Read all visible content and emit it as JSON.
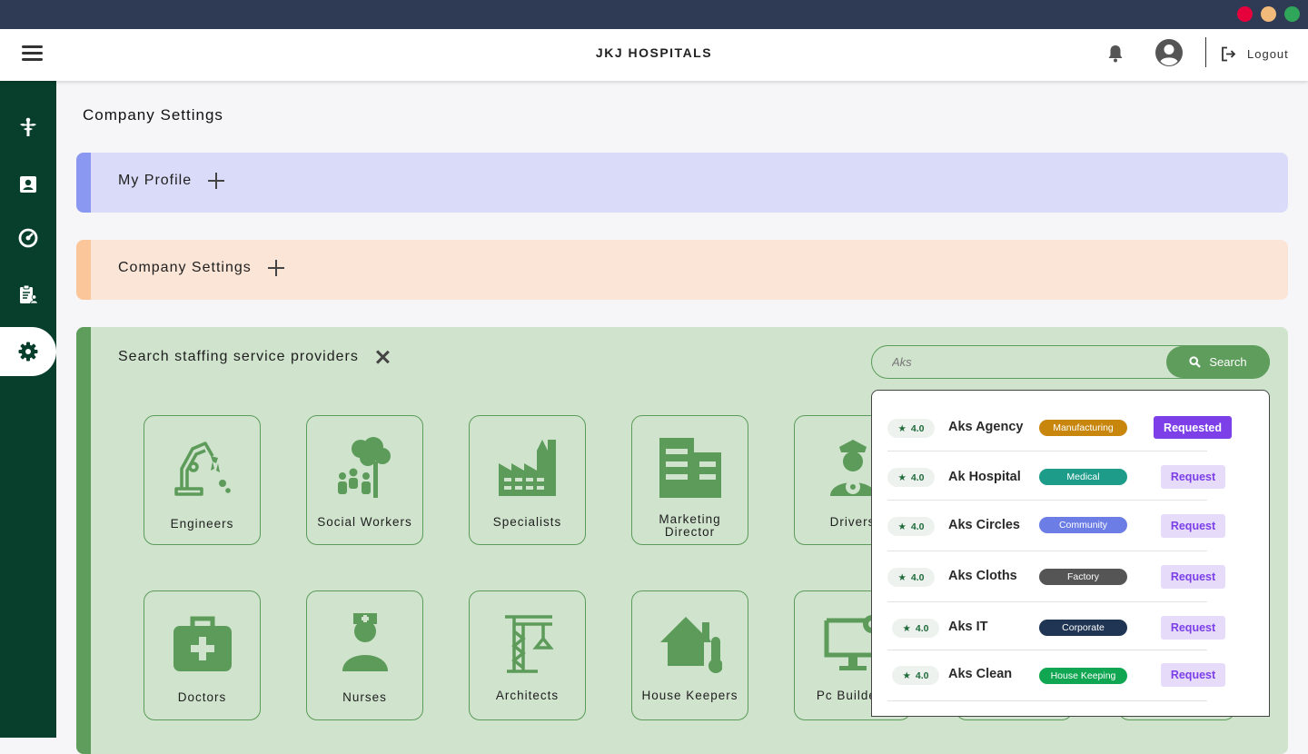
{
  "window": {
    "controls": [
      "close",
      "minimize",
      "maximize"
    ]
  },
  "header": {
    "brand": "JKJ HOSPITALS",
    "logout_label": "Logout"
  },
  "sidebar": {
    "items": [
      "hospital-icon",
      "profile-card-icon",
      "dashboard-gauge-icon",
      "clipboard-users-icon",
      "settings-icon"
    ],
    "active": "settings-icon"
  },
  "page": {
    "title": "Company Settings"
  },
  "panels": {
    "profile": {
      "title": "My Profile"
    },
    "company": {
      "title": "Company Settings"
    },
    "search": {
      "title": "Search staffing service providers"
    }
  },
  "search": {
    "value": "Aks",
    "button_label": "Search"
  },
  "categories": [
    {
      "label": "Engineers",
      "icon": "robot-arm-icon"
    },
    {
      "label": "Social Workers",
      "icon": "people-tree-icon"
    },
    {
      "label": "Specialists",
      "icon": "factory-icon"
    },
    {
      "label": "Marketing Director",
      "icon": "office-building-icon"
    },
    {
      "label": "Drivers",
      "icon": "driver-icon"
    },
    {
      "label": "Doctors",
      "icon": "medical-kit-icon"
    },
    {
      "label": "Nurses",
      "icon": "nurse-icon"
    },
    {
      "label": "Architects",
      "icon": "crane-icon"
    },
    {
      "label": "House Keepers",
      "icon": "house-thermometer-icon"
    },
    {
      "label": "Pc Builders",
      "icon": "computer-gear-icon"
    }
  ],
  "results": [
    {
      "rating": "4.0",
      "name": "Aks Agency",
      "tag": "Manufacturing",
      "tag_color": "#c8860c",
      "action": "Requested"
    },
    {
      "rating": "4.0",
      "name": "Ak Hospital",
      "tag": "Medical",
      "tag_color": "#1e9c8a",
      "action": "Request"
    },
    {
      "rating": "4.0",
      "name": "Aks Circles",
      "tag": "Community",
      "tag_color": "#6c7ee6",
      "action": "Request"
    },
    {
      "rating": "4.0",
      "name": "Aks Cloths",
      "tag": "Factory",
      "tag_color": "#555555",
      "action": "Request"
    },
    {
      "rating": "4.0",
      "name": "Aks IT",
      "tag": "Corporate",
      "tag_color": "#1f3553",
      "action": "Request"
    },
    {
      "rating": "4.0",
      "name": "Aks Clean",
      "tag": "House Keeping",
      "tag_color": "#11a651",
      "action": "Request"
    }
  ],
  "colors": {
    "sidebar": "#073f2c",
    "accent_green": "#5f9d5c",
    "requested": "#7c3fe8",
    "request_bg": "#e6dcf9"
  }
}
